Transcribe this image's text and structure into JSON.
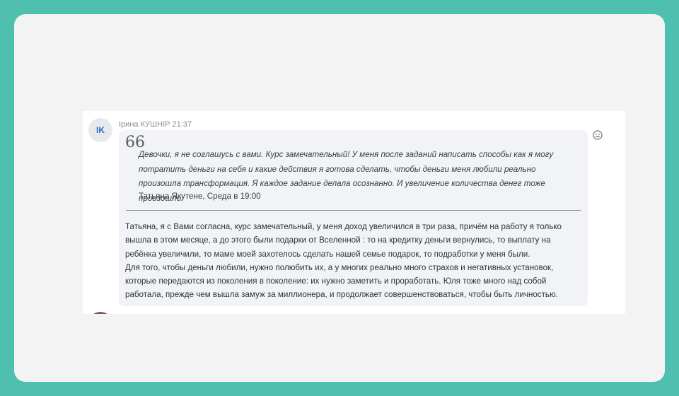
{
  "message": {
    "avatar_initials": "IK",
    "author": "Ірина КУШНІР",
    "time": "21:37",
    "quote_mark": "66",
    "quote": {
      "text": "Девочки, я не соглашусь с вами. Курс замечательный! У меня после заданий написать способы как я могу потратить деньги на себя и какие действия я готова сделать, чтобы деньги меня любили реально произошла трансформация. Я каждое задание делала осознанно. И увеличение количества денег тоже произошло.",
      "attribution": "Татьяна Якутене, Среда в 19:00"
    },
    "reply_paragraphs": [
      "Татьяна, я с Вами согласна, курс замечательный, у меня доход увеличился в три раза, причём на работу я только вышла в этом месяце, а до этого были подарки от Вселенной : то на кредитку деньги вернулись, то выплату на ребёнка увеличили, то маме моей захотелось сделать нашей семье подарок, то подработки у меня были.",
      "Для того, чтобы деньги любили, нужно полюбить их, а у многих реально много страхов и негативных установок, которые передаются из поколения в поколение: их нужно заметить и проработать. Юля тоже много над собой работала, прежде чем вышла замуж за миллионера, и продолжает совершенствоваться, чтобы быть личностью."
    ]
  },
  "icons": {
    "reaction": "smile-icon"
  },
  "colors": {
    "frame_border": "#4fbfaf",
    "background": "#f3f3f3",
    "bubble": "#f1f3f6",
    "avatar_text": "#2a6fb8"
  }
}
